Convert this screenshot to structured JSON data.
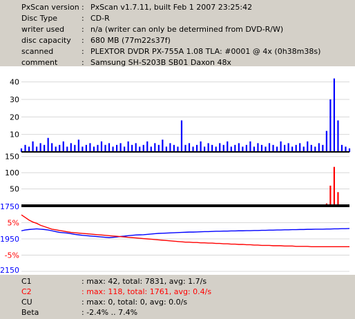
{
  "info": [
    {
      "key": "PxScan version",
      "value": "PxScan v1.7.11, built Feb  1 2007 23:25:42"
    },
    {
      "key": "Disc Type",
      "value": "CD-R"
    },
    {
      "key": "writer used",
      "value": "n/a (writer can only be determined from DVD-R/W)"
    },
    {
      "key": "disc capacity",
      "value": "680 MB (77m22s37f)"
    },
    {
      "key": "scanned",
      "value": "PLEXTOR DVDR PX-755A 1.08 TLA: #0001 @ 4x (0h38m38s)"
    },
    {
      "key": "comment",
      "value": "Samsung SH-S203B SB01 Daxon 48x"
    }
  ],
  "separator": ":",
  "colors": {
    "c1": "#0000ff",
    "c2": "#ff0000",
    "jitter": "#0000ff",
    "beta": "#ff0000"
  },
  "chart_data": [
    {
      "type": "area",
      "series": [
        {
          "name": "C1",
          "values": [
            2,
            4,
            3,
            6,
            3,
            5,
            4,
            8,
            5,
            3,
            4,
            6,
            3,
            5,
            4,
            7,
            3,
            4,
            5,
            3,
            4,
            6,
            4,
            5,
            3,
            4,
            5,
            3,
            6,
            4,
            5,
            3,
            4,
            6,
            3,
            5,
            4,
            7,
            3,
            5,
            4,
            3,
            18,
            4,
            5,
            3,
            4,
            6,
            3,
            5,
            4,
            3,
            5,
            4,
            6,
            3,
            4,
            5,
            3,
            4,
            6,
            3,
            5,
            4,
            3,
            5,
            4,
            3,
            6,
            4,
            5,
            3,
            4,
            5,
            3,
            6,
            4,
            3,
            5,
            4,
            12,
            30,
            42,
            18,
            4,
            3,
            2
          ]
        }
      ],
      "ylim": [
        0,
        45
      ],
      "yticks": [
        "40",
        "30",
        "20",
        "10"
      ]
    },
    {
      "type": "area",
      "series": [
        {
          "name": "C2",
          "values": [
            0,
            0,
            0,
            0,
            0,
            0,
            0,
            0,
            0,
            0,
            0,
            0,
            0,
            0,
            0,
            0,
            0,
            0,
            0,
            0,
            0,
            0,
            0,
            0,
            0,
            0,
            0,
            0,
            0,
            0,
            0,
            0,
            0,
            0,
            0,
            0,
            0,
            0,
            0,
            0,
            0,
            0,
            0,
            0,
            0,
            0,
            0,
            0,
            0,
            0,
            0,
            0,
            0,
            0,
            0,
            0,
            0,
            0,
            0,
            0,
            0,
            0,
            0,
            0,
            0,
            0,
            0,
            0,
            0,
            0,
            0,
            0,
            0,
            0,
            0,
            0,
            0,
            0,
            0,
            0,
            5,
            60,
            118,
            40,
            0,
            0,
            0
          ]
        }
      ],
      "ylim": [
        0,
        160
      ],
      "yticks": [
        "150",
        "100",
        "50"
      ]
    },
    {
      "type": "line",
      "series": [
        {
          "name": "Jitter",
          "values": [
            1900,
            1895,
            1892,
            1890,
            1888,
            1890,
            1892,
            1895,
            1900,
            1905,
            1910,
            1912,
            1914,
            1918,
            1922,
            1925,
            1928,
            1930,
            1932,
            1934,
            1936,
            1938,
            1940,
            1942,
            1940,
            1938,
            1935,
            1933,
            1930,
            1928,
            1926,
            1925,
            1924,
            1922,
            1920,
            1918,
            1916,
            1915,
            1914,
            1913,
            1912,
            1911,
            1910,
            1909,
            1908,
            1908,
            1907,
            1906,
            1905,
            1905,
            1904,
            1903,
            1903,
            1902,
            1902,
            1901,
            1901,
            1900,
            1900,
            1899,
            1899,
            1898,
            1898,
            1897,
            1897,
            1896,
            1896,
            1895,
            1895,
            1894,
            1894,
            1893,
            1893,
            1892,
            1892,
            1891,
            1891,
            1890,
            1890,
            1890,
            1889,
            1889,
            1888,
            1888,
            1887,
            1887,
            1886
          ]
        },
        {
          "name": "Beta",
          "values": [
            7.4,
            6.6,
            5.8,
            5.2,
            4.8,
            4.2,
            3.8,
            3.4,
            3.0,
            2.8,
            2.6,
            2.4,
            2.2,
            2.0,
            1.9,
            1.8,
            1.7,
            1.6,
            1.5,
            1.4,
            1.3,
            1.2,
            1.1,
            1.0,
            0.9,
            0.8,
            0.7,
            0.6,
            0.5,
            0.4,
            0.3,
            0.2,
            0.1,
            0.0,
            -0.1,
            -0.2,
            -0.3,
            -0.4,
            -0.5,
            -0.6,
            -0.7,
            -0.8,
            -0.9,
            -1.0,
            -1.0,
            -1.1,
            -1.1,
            -1.2,
            -1.2,
            -1.3,
            -1.3,
            -1.4,
            -1.4,
            -1.5,
            -1.5,
            -1.6,
            -1.6,
            -1.7,
            -1.7,
            -1.8,
            -1.8,
            -1.9,
            -1.9,
            -2.0,
            -2.0,
            -2.0,
            -2.1,
            -2.1,
            -2.1,
            -2.2,
            -2.2,
            -2.2,
            -2.3,
            -2.3,
            -2.3,
            -2.3,
            -2.4,
            -2.4,
            -2.4,
            -2.4,
            -2.4,
            -2.4,
            -2.4,
            -2.4,
            -2.4,
            -2.4,
            -2.4
          ]
        }
      ],
      "yticks_left": [
        "1750",
        "1950",
        "2150"
      ],
      "yticks_pct": [
        "5%",
        "-5%"
      ],
      "ylim_jitter": [
        1750,
        2150
      ],
      "ylim_beta": [
        -10,
        10
      ]
    }
  ],
  "stats": [
    {
      "key": "C1",
      "value": ": max: 42, total: 7831, avg: 1.7/s",
      "highlight": false
    },
    {
      "key": "C2",
      "value": ": max: 118, total: 1761, avg: 0.4/s",
      "highlight": true
    },
    {
      "key": "CU",
      "value": ": max: 0, total: 0, avg: 0.0/s",
      "highlight": false
    },
    {
      "key": "Beta",
      "value": ": -2.4% .. 7.4%",
      "highlight": false
    }
  ]
}
